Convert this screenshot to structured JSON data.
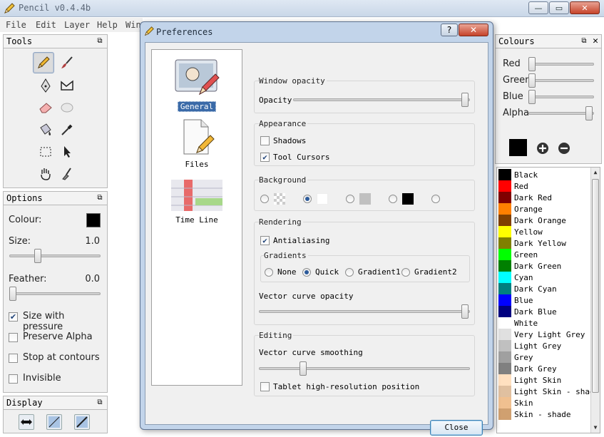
{
  "window": {
    "title": "Pencil v0.4.4b",
    "buttons": [
      "—",
      "▭",
      "✕"
    ]
  },
  "menu": [
    "File",
    "Edit",
    "Layer",
    "Help",
    "Win"
  ],
  "tools_panel": {
    "title": "Tools"
  },
  "options_panel": {
    "title": "Options",
    "colour_label": "Colour:",
    "colour_value": "#000000",
    "size_label": "Size:",
    "size_value": "1.0",
    "size_fraction": 0.3,
    "feather_label": "Feather:",
    "feather_value": "0.0",
    "feather_fraction": 0.0,
    "checks": [
      {
        "label": "Size with pressure",
        "checked": true
      },
      {
        "label": "Preserve Alpha",
        "checked": false
      },
      {
        "label": "Stop at contours",
        "checked": false
      },
      {
        "label": "Invisible",
        "checked": false
      }
    ]
  },
  "display_panel": {
    "title": "Display"
  },
  "preferences": {
    "title": "Preferences",
    "title_buttons": [
      "?",
      "✕"
    ],
    "pages": [
      {
        "label": "General",
        "selected": true
      },
      {
        "label": "Files",
        "selected": false
      },
      {
        "label": "Time Line",
        "selected": false
      }
    ],
    "window_opacity": {
      "title": "Window opacity",
      "label": "Opacity",
      "fraction": 1.0
    },
    "appearance": {
      "title": "Appearance",
      "shadows": {
        "label": "Shadows",
        "checked": false
      },
      "tool_cursors": {
        "label": "Tool Cursors",
        "checked": true
      }
    },
    "background": {
      "title": "Background",
      "selected_index": 1
    },
    "rendering": {
      "title": "Rendering",
      "antialiasing": {
        "label": "Antialiasing",
        "checked": true
      },
      "gradients_title": "Gradients",
      "gradients": [
        {
          "label": "None",
          "selected": false
        },
        {
          "label": "Quick",
          "selected": true
        },
        {
          "label": "Gradient1",
          "selected": false
        },
        {
          "label": "Gradient2",
          "selected": false
        }
      ],
      "vector_opacity_label": "Vector curve opacity",
      "vector_opacity_fraction": 1.0
    },
    "editing": {
      "title": "Editing",
      "smoothing_label": "Vector curve smoothing",
      "smoothing_fraction": 0.2,
      "tablet": {
        "label": "Tablet high-resolution position",
        "checked": false
      }
    },
    "close_label": "Close"
  },
  "colours_panel": {
    "title": "Colours",
    "sliders": [
      {
        "label": "Red",
        "fraction": 0.0
      },
      {
        "label": "Green",
        "fraction": 0.0
      },
      {
        "label": "Blue",
        "fraction": 0.0
      },
      {
        "label": "Alpha",
        "fraction": 1.0
      }
    ],
    "current": "#000000",
    "palette": [
      {
        "name": "Black",
        "color": "#000000"
      },
      {
        "name": "Red",
        "color": "#ff0000"
      },
      {
        "name": "Dark Red",
        "color": "#800000"
      },
      {
        "name": "Orange",
        "color": "#ff8000"
      },
      {
        "name": "Dark Orange",
        "color": "#804000"
      },
      {
        "name": "Yellow",
        "color": "#ffff00"
      },
      {
        "name": "Dark Yellow",
        "color": "#808000"
      },
      {
        "name": "Green",
        "color": "#00ff00"
      },
      {
        "name": "Dark Green",
        "color": "#008000"
      },
      {
        "name": "Cyan",
        "color": "#00ffff"
      },
      {
        "name": "Dark Cyan",
        "color": "#008080"
      },
      {
        "name": "Blue",
        "color": "#0000ff"
      },
      {
        "name": "Dark Blue",
        "color": "#000080"
      },
      {
        "name": "White",
        "color": "#ffffff"
      },
      {
        "name": "Very Light Grey",
        "color": "#e0e0e0"
      },
      {
        "name": "Light Grey",
        "color": "#c0c0c0"
      },
      {
        "name": "Grey",
        "color": "#a0a0a0"
      },
      {
        "name": "Dark Grey",
        "color": "#808080"
      },
      {
        "name": "Light Skin",
        "color": "#ffe0c0"
      },
      {
        "name": "Light Skin - shade",
        "color": "#e0c0a0"
      },
      {
        "name": "Skin",
        "color": "#f0c090"
      },
      {
        "name": "Skin - shade",
        "color": "#d0a070"
      }
    ]
  }
}
